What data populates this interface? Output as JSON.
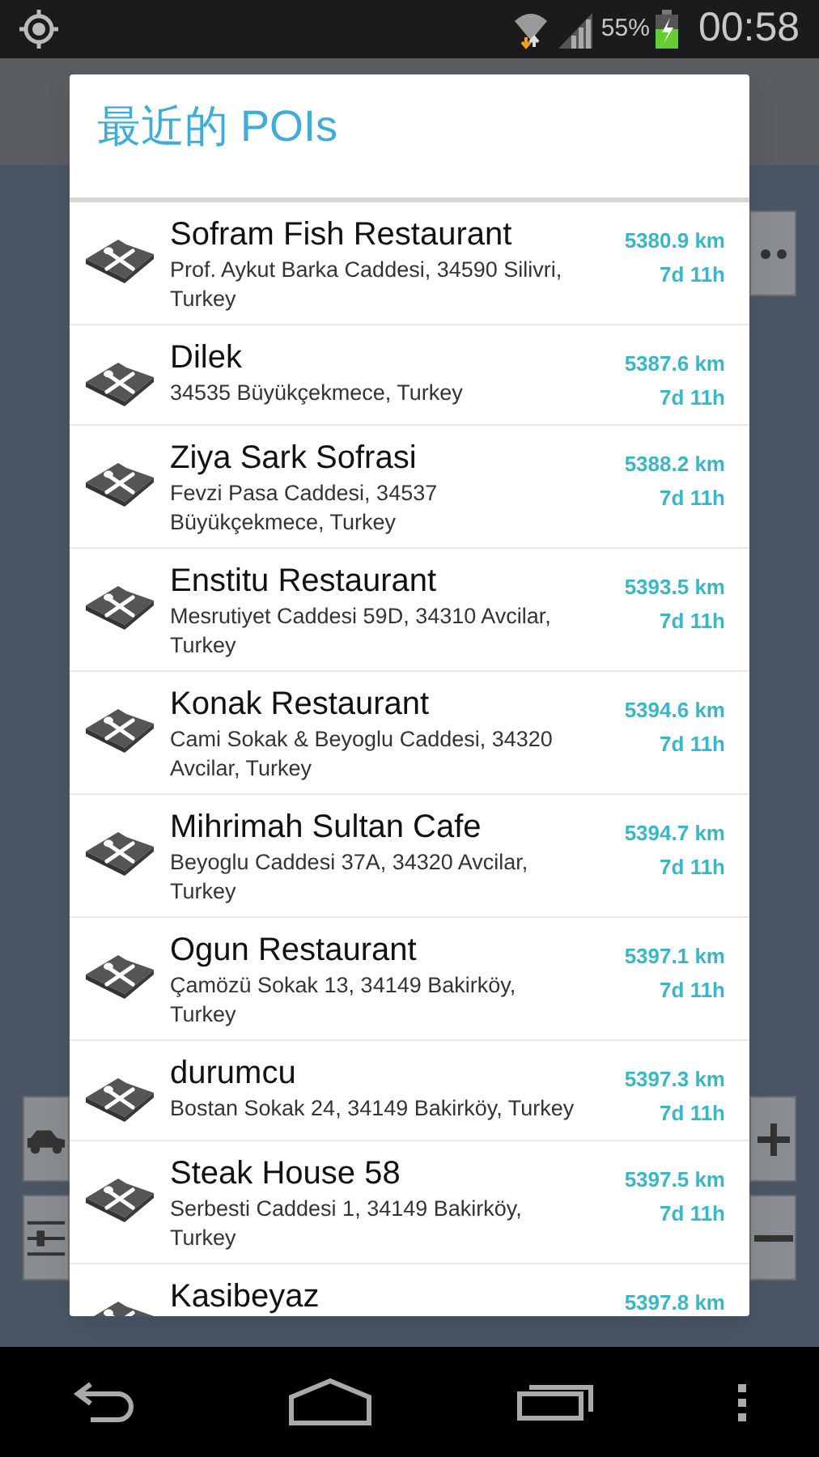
{
  "status_bar": {
    "battery_percent": "55%",
    "time": "00:58"
  },
  "dialog": {
    "title": "最近的 POIs",
    "items": [
      {
        "name": "Sofram Fish Restaurant",
        "address": "Prof. Aykut Barka Caddesi, 34590 Silivri, Turkey",
        "distance": "5380.9 km",
        "duration": "7d 11h"
      },
      {
        "name": "Dilek",
        "address": "34535 Büyükçekmece, Turkey",
        "distance": "5387.6 km",
        "duration": "7d 11h"
      },
      {
        "name": "Ziya Sark Sofrasi",
        "address": "Fevzi Pasa Caddesi, 34537 Büyükçekmece, Turkey",
        "distance": "5388.2 km",
        "duration": "7d 11h"
      },
      {
        "name": "Enstitu Restaurant",
        "address": "Mesrutiyet Caddesi 59D, 34310 Avcilar, Turkey",
        "distance": "5393.5 km",
        "duration": "7d 11h"
      },
      {
        "name": "Konak Restaurant",
        "address": "Cami Sokak & Beyoglu Caddesi, 34320 Avcilar, Turkey",
        "distance": "5394.6 km",
        "duration": "7d 11h"
      },
      {
        "name": "Mihrimah Sultan Cafe",
        "address": "Beyoglu Caddesi 37A, 34320 Avcilar, Turkey",
        "distance": "5394.7 km",
        "duration": "7d 11h"
      },
      {
        "name": "Ogun Restaurant",
        "address": "Çamözü Sokak 13, 34149 Bakirköy, Turkey",
        "distance": "5397.1 km",
        "duration": "7d 11h"
      },
      {
        "name": "durumcu",
        "address": "Bostan Sokak 24, 34149 Bakirköy, Turkey",
        "distance": "5397.3 km",
        "duration": "7d 11h"
      },
      {
        "name": "Steak House 58",
        "address": "Serbesti Caddesi 1, 34149 Bakirköy, Turkey",
        "distance": "5397.5 km",
        "duration": "7d 11h"
      },
      {
        "name": "Kasibeyaz",
        "distance": "5397.8 km"
      }
    ]
  }
}
